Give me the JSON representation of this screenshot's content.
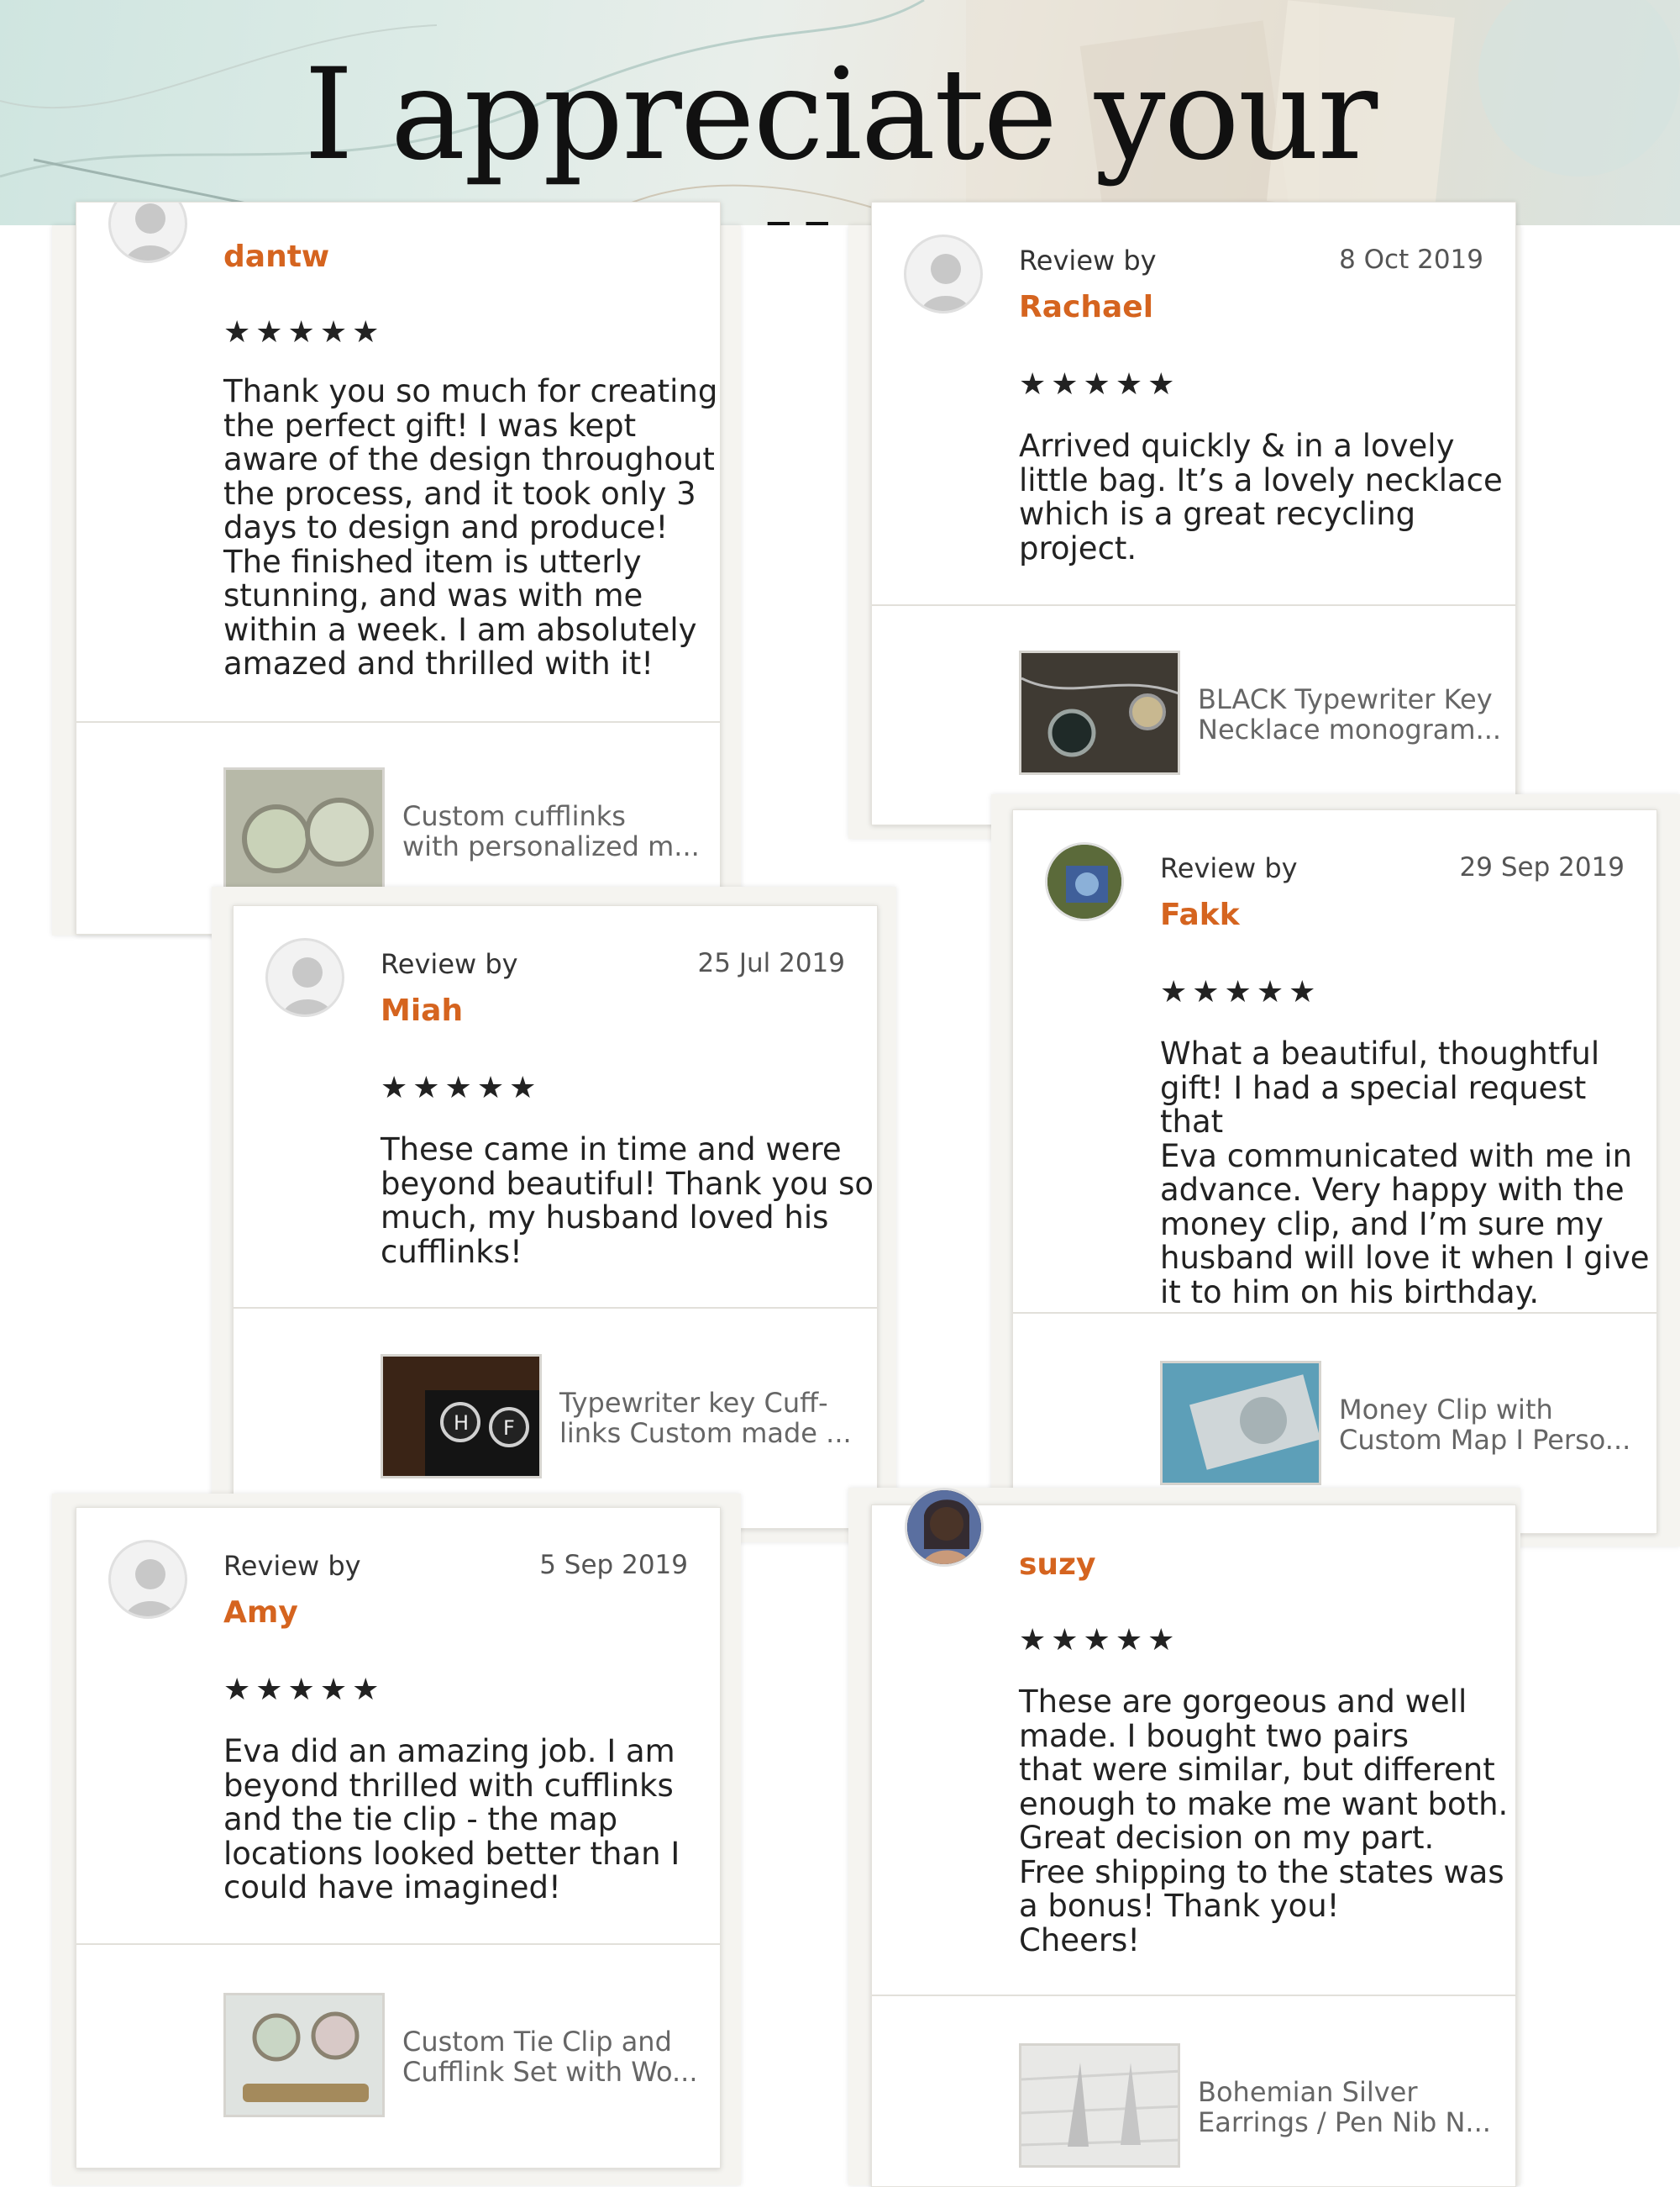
{
  "header": {
    "title": "I appreciate your feedback!"
  },
  "review_by_label": "Review by",
  "stars": "★★★★★",
  "reviews": [
    {
      "name": "dantw",
      "date": "",
      "text": "Thank you so much for creating\nthe perfect gift! I was kept\naware of the design throughout\nthe process, and it took only 3\ndays to design and produce!\nThe finished item is utterly\nstunning, and was with me\nwithin a week. I am absolutely\namazed and thrilled with it!",
      "product": "Custom cufflinks\nwith personalized m..."
    },
    {
      "name": "Rachael",
      "date": "8 Oct 2019",
      "text": "Arrived quickly & in a lovely\nlittle bag. It’s a lovely necklace\nwhich is a  great recycling\nproject.",
      "product": "BLACK Typewriter Key\nNecklace monogram..."
    },
    {
      "name": "Miah",
      "date": "25 Jul 2019",
      "text": "These came in time and were\nbeyond beautiful! Thank you so\nmuch, my husband loved his\ncufflinks!",
      "product": "Typewriter key Cuff-\nlinks Custom made ..."
    },
    {
      "name": "Fakk",
      "date": "29 Sep 2019",
      "text": "What a beautiful, thoughtful\ngift! I had a special request that\nEva communicated with me in\nadvance. Very happy with the\nmoney clip, and I’m sure my\nhusband will love it when I give\nit to him on his birthday.",
      "product": "Money Clip with\nCustom Map I Perso..."
    },
    {
      "name": "Amy",
      "date": "5 Sep 2019",
      "text": "Eva did an amazing job. I am\nbeyond thrilled with cufflinks\nand the tie clip - the map\nlocations looked better than I\ncould have imagined!",
      "product": "Custom Tie Clip and\nCufflink Set with Wo..."
    },
    {
      "name": "suzy",
      "date": "",
      "text": "These are gorgeous and well\nmade.  I bought two pairs\nthat were similar, but different\nenough to make me want both.\nGreat decision on my part.\nFree shipping to the states was\na bonus!  Thank you!\nCheers!",
      "product": "Bohemian Silver\nEarrings / Pen Nib N..."
    }
  ]
}
